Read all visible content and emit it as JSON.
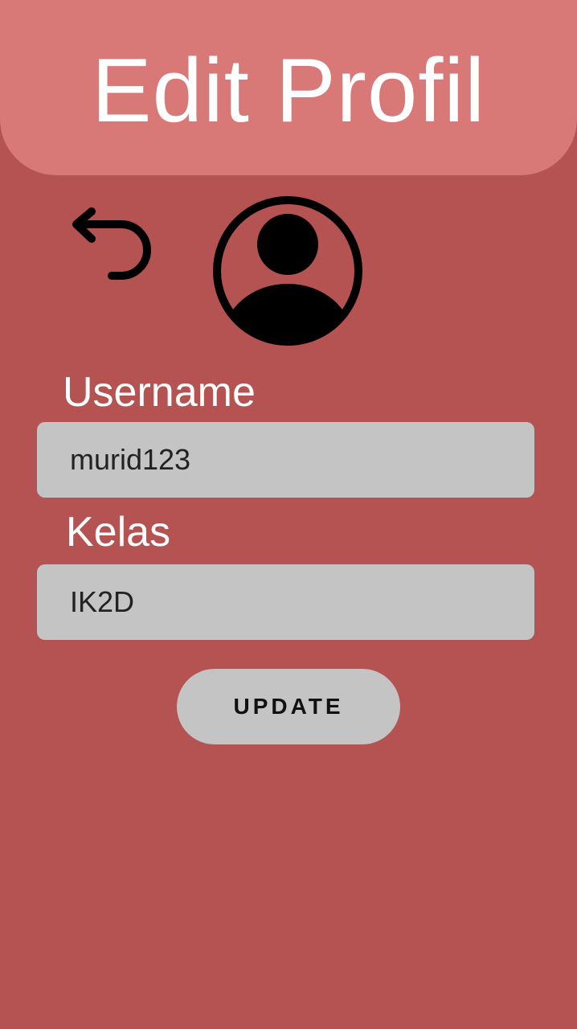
{
  "header": {
    "title": "Edit Profil"
  },
  "icons": {
    "back": "back-arrow-icon",
    "avatar": "user-avatar-icon"
  },
  "form": {
    "username": {
      "label": "Username",
      "value": "murid123"
    },
    "kelas": {
      "label": "Kelas",
      "value": "IK2D"
    },
    "update_label": "UPDATE"
  },
  "colors": {
    "background": "#b55352",
    "header": "#d87877",
    "field": "#c4c4c4",
    "text_light": "#ffffff",
    "text_dark": "#222222"
  }
}
